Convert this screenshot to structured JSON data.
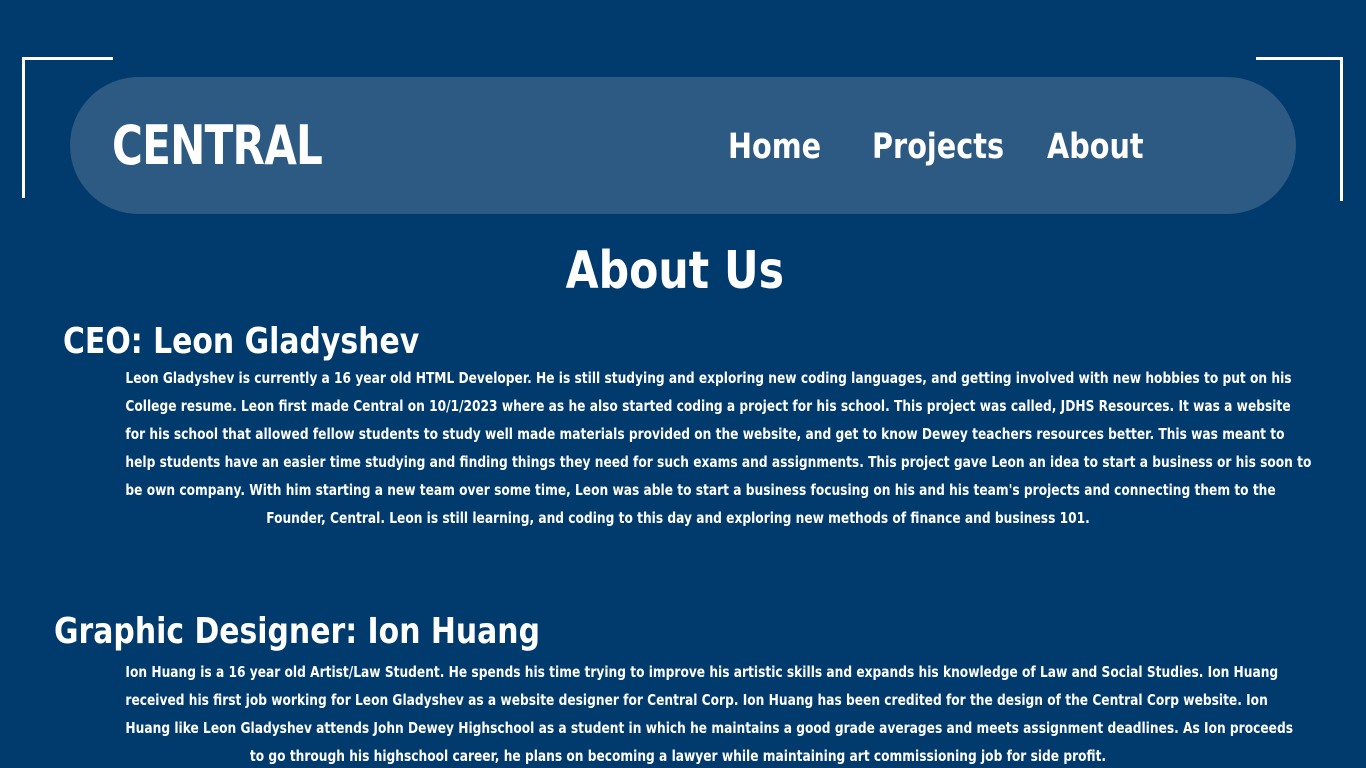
{
  "nav": {
    "logo": "CENTRAL",
    "links": [
      "Home",
      "Projects",
      "About"
    ]
  },
  "page": {
    "title": "About Us"
  },
  "ceo": {
    "heading": "CEO: Leon Gladyshev",
    "bio_lines": [
      "Leon Gladyshev is currently a 16 year old HTML Developer. He is still studying and exploring new coding languages, and getting involved with new hobbies to put on his",
      "College resume. Leon first made Central on 10/1/2023 where as he also started coding a project for his school. This project was called, JDHS Resources. It was a website",
      "for his school that allowed fellow students to study well made materials provided on the website, and get to know Dewey teachers resources better. This was meant to",
      "help students have an easier time studying and finding things they need for such exams and assignments. This project gave Leon an idea to start a business or his soon to",
      "be own company. With him starting a new team over some time, Leon was able to start a business focusing on his and his team's projects and connecting them to the",
      "Founder, Central. Leon is still learning, and coding to this day and exploring new methods of finance and business 101."
    ]
  },
  "designer": {
    "heading": "Graphic Designer: Ion Huang",
    "bio_lines": [
      "Ion Huang is a 16 year old Artist/Law Student. He spends his time trying to improve his artistic skills and expands his knowledge of Law and Social Studies. Ion Huang",
      "received his first job working for Leon Gladyshev as a website designer for Central Corp. Ion Huang has been credited for the design of the Central Corp website. Ion",
      "Huang like Leon Gladyshev attends John Dewey Highschool as a student in which he maintains a good grade  averages and meets assignment deadlines. As Ion proceeds",
      "to go through his highschool career, he plans on becoming a lawyer while maintaining art commissioning job for side profit."
    ]
  },
  "colors": {
    "background": "#013b6e",
    "navbar": "#2d5a83",
    "text": "#ffffff"
  }
}
